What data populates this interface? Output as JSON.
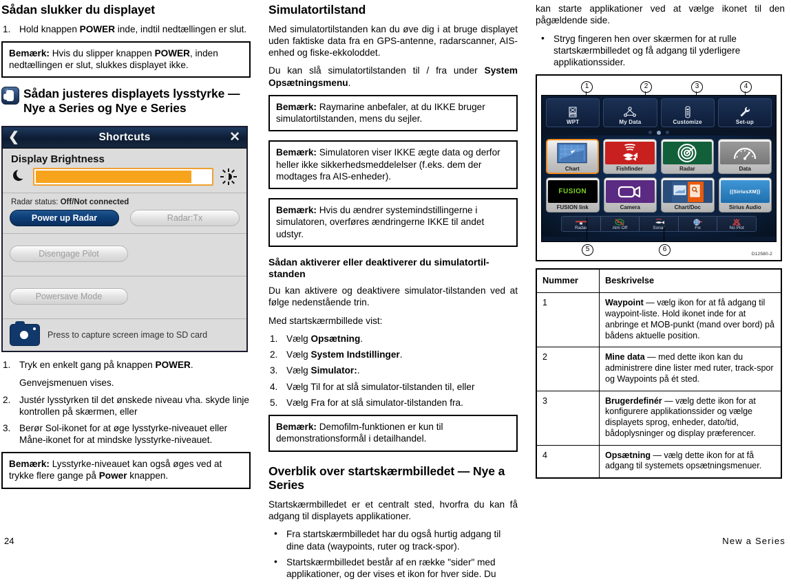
{
  "page": {
    "number": "24",
    "book_title": "New a Series"
  },
  "left_column": {
    "heading1": "Sådan slukker du displayet",
    "step1": {
      "num": "1.",
      "text_before": "Hold knappen ",
      "bold": "POWER",
      "text_after": " inde, indtil nedtællingen er slut."
    },
    "note1": {
      "label": "Bemærk:",
      "text_a": " Hvis du slipper knappen ",
      "bold": "POWER",
      "text_b": ", inden nedtællingen er slut, slukkes displayet ikke."
    },
    "heading2": "Sådan justeres displayets lysstyrke — Nye a Series og Nye e Series",
    "shortcuts_screen": {
      "title": "Shortcuts",
      "back_icon": "back-chevron-icon",
      "close_icon": "close-x-icon",
      "brightness_label": "Display Brightness",
      "brightness_value_percent": 89,
      "moon_icon": "moon-icon",
      "sun_icon": "sun-icon",
      "radar_status_label": "Radar status:",
      "radar_status_value": "Off/Not connected",
      "power_up_radar_button": "Power up Radar",
      "radar_tx_button": "Radar:Tx",
      "disengage_pilot_button": "Disengage Pilot",
      "powersave_mode_button": "Powersave Mode",
      "camera_icon": "camera-icon",
      "capture_text": "Press to capture screen image to SD card"
    },
    "steps": [
      {
        "num": "1.",
        "text_before": "Tryk en enkelt gang på knappen ",
        "bold": "POWER",
        "text_after": ".",
        "sub": "Genvejsmenuen vises."
      },
      {
        "num": "2.",
        "text_before": "Justér lysstyrken til det ønskede niveau vha. skyde linje kontrollen på skærmen, eller",
        "bold": "",
        "text_after": ""
      },
      {
        "num": "3.",
        "text_before": "Berør Sol-ikonet for at øge lysstyrke-niveauet eller Måne-ikonet for at mindske lysstyrke-niveauet.",
        "bold": "",
        "text_after": ""
      }
    ],
    "note2": {
      "label": "Bemærk:",
      "text_a": " Lysstyrke-niveauet kan også øges ved at trykke flere gange på ",
      "bold": "Power",
      "text_b": " knappen."
    }
  },
  "middle_column": {
    "heading1": "Simulatortilstand",
    "para1": "Med simulatortilstanden kan du øve dig i at bruge displayet uden faktiske data fra en GPS-antenne, radarscanner, AIS-enhed og fiske-ekkoloddet.",
    "para2": {
      "text_a": "Du kan slå simulatortilstanden til / fra under ",
      "bold": "System Opsætningsmenu",
      "text_b": "."
    },
    "note1": {
      "label": "Bemærk:",
      "text": " Raymarine anbefaler, at du IKKE bruger simulatortilstanden, mens du sejler."
    },
    "note2": {
      "label": "Bemærk:",
      "text": " Simulatoren viser IKKE ægte data og derfor heller ikke sikkerhedsmeddelelser (f.eks. dem der modtages fra AIS-enheder)."
    },
    "note3": {
      "label": "Bemærk:",
      "text": " Hvis du ændrer systemindstillingerne i simulatoren, overføres ændringerne IKKE til andet udstyr."
    },
    "heading2": "Sådan aktiverer eller deaktiverer du simulatortil-standen",
    "para3": "Du kan aktivere og deaktivere simulator-tilstanden ved at følge nedenstående trin.",
    "para4": "Med startskærmbillede vist:",
    "steps": [
      {
        "num": "1.",
        "pre": "Vælg ",
        "bold": "Opsætning",
        "post": "."
      },
      {
        "num": "2.",
        "pre": "Vælg ",
        "bold": "System Indstillinger",
        "post": "."
      },
      {
        "num": "3.",
        "pre": "Vælg ",
        "bold": "Simulator:",
        "post": "."
      },
      {
        "num": "4.",
        "pre": "Vælg Til for at slå simulator-tilstanden til, eller",
        "bold": "",
        "post": ""
      },
      {
        "num": "5.",
        "pre": "Vælg Fra for at slå simulator-tilstanden fra.",
        "bold": "",
        "post": ""
      }
    ],
    "note4": {
      "label": "Bemærk:",
      "text": "  Demofilm-funktionen er kun til demonstrationsformål i detailhandel."
    },
    "heading3": "Overblik over startskærmbilledet — Nye a Series",
    "para5": "Startskærmbilledet er et centralt sted, hvorfra du kan få adgang til displayets applikationer.",
    "bullets": [
      "Fra startskærmbilledet har du også hurtig adgang til dine data (waypoints, ruter og track-spor).",
      "Startskærmbilledet består af en række \"sider\" med applikationer, og der vises et ikon for hver side. Du"
    ]
  },
  "right_column": {
    "continued_para": "kan starte applikationer ved at vælge ikonet til den pågældende side.",
    "bullets": [
      "Stryg fingeren hen over skærmen for at rulle startskærmbilledet og få adgang til yderligere applikationssider."
    ],
    "figure": {
      "code": "D12580-2",
      "callouts": [
        "1",
        "2",
        "3",
        "4",
        "5",
        "6"
      ],
      "top_buttons": [
        {
          "label": "WPT",
          "icon": "waypoint-icon"
        },
        {
          "label": "My Data",
          "icon": "my-data-icon"
        },
        {
          "label": "Customize",
          "icon": "customize-icon"
        },
        {
          "label": "Set-up",
          "icon": "wrench-icon"
        }
      ],
      "page_dots": 3,
      "page_dot_active_index": 1,
      "apps_row1": [
        {
          "label": "Chart",
          "icon": "chart-icon",
          "selected": true
        },
        {
          "label": "Fishfinder",
          "icon": "fishfinder-icon",
          "selected": false
        },
        {
          "label": "Radar",
          "icon": "radar-icon",
          "selected": false
        },
        {
          "label": "Data",
          "icon": "data-gauge-icon",
          "selected": false
        }
      ],
      "apps_row2": [
        {
          "label": "FUSION link",
          "icon": "fusion-link-icon",
          "selected": false
        },
        {
          "label": "Camera",
          "icon": "camera-app-icon",
          "selected": false
        },
        {
          "label": "Chart/Doc",
          "icon": "chart-doc-icon",
          "selected": false
        },
        {
          "label": "Sirius Audio",
          "icon": "sirius-audio-icon",
          "selected": false
        }
      ],
      "status_bar": [
        {
          "label": "Radar",
          "icon": "radar-status-icon"
        },
        {
          "label": "Alm Off",
          "icon": "alarm-off-icon"
        },
        {
          "label": "Sonar",
          "icon": "sonar-status-icon"
        },
        {
          "label": "Fix",
          "icon": "gps-fix-icon"
        },
        {
          "label": "No Plot",
          "icon": "no-plot-icon"
        }
      ]
    },
    "table": {
      "headers": [
        "Nummer",
        "Beskrivelse"
      ],
      "rows": [
        {
          "num": "1",
          "bold": "Waypoint",
          "text": " — vælg ikon for at få adgang til waypoint-liste. Hold ikonet inde for at anbringe et MOB-punkt (mand over bord) på bådens aktuelle position."
        },
        {
          "num": "2",
          "bold": "Mine data",
          "text": " — med dette ikon kan du administrere dine lister med ruter, track-spor og Waypoints på ét sted."
        },
        {
          "num": "3",
          "bold": "Brugerdefinér",
          "text": " — vælg dette ikon for at konfigurere applikationssider og vælge displayets sprog, enheder, dato/tid, bådoplysninger og display præferencer."
        },
        {
          "num": "4",
          "bold": "Opsætning",
          "text": " — vælg dette ikon for at få adgang til systemets opsætningsmenuer."
        }
      ]
    }
  },
  "colors": {
    "accent_orange": "#f7a31c",
    "button_blue": "#0d3f78",
    "screen_bg": "#0b1930",
    "fishfinder_red": "#c8201f",
    "radar_green": "#12603a",
    "camera_purple": "#5b2a82",
    "sirius_blue": "#2f87c9"
  }
}
